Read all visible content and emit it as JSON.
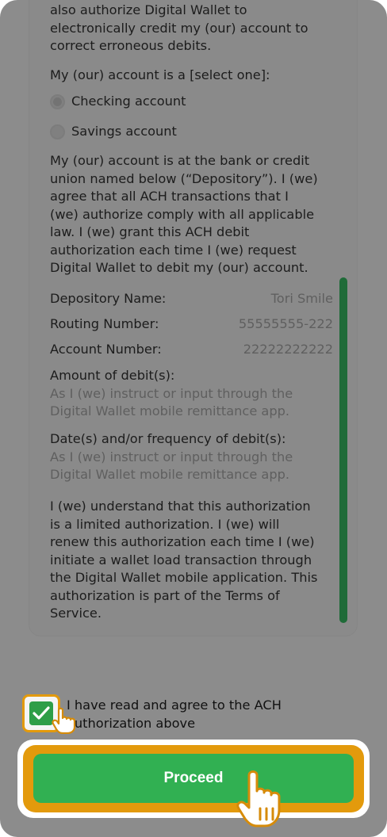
{
  "auth_text": {
    "intro_lines": [
      "also authorize Digital Wallet to",
      "electronically credit my (our) account to",
      "correct erroneous debits."
    ],
    "account_type_prompt": "My (our) account is a [select one]:",
    "account_options": [
      {
        "label": "Checking account",
        "selected": true
      },
      {
        "label": "Savings account",
        "selected": false
      }
    ],
    "depository_paragraph": [
      "My (our) account is at the bank or credit",
      "union named below (“Depository”). I (we)",
      "agree that all ACH transactions that I",
      "(we) authorize comply with all applicable",
      "law.  I (we) grant this ACH debit",
      "authorization each time I (we) request",
      "Digital Wallet to debit my (our) account."
    ],
    "fields": [
      {
        "label": "Depository Name:",
        "value": "Tori Smile"
      },
      {
        "label": "Routing Number:",
        "value": "55555555-222"
      },
      {
        "label": "Account Number:",
        "value": "22222222222"
      }
    ],
    "amount_label": "Amount of debit(s):",
    "amount_value_lines": [
      "As I (we) instruct or input through the",
      "Digital Wallet mobile remittance app."
    ],
    "date_label": "Date(s) and/or frequency of debit(s):",
    "date_value_lines": [
      "As I (we) instruct or input through the",
      "Digital Wallet mobile remittance app."
    ],
    "closing_paragraph": [
      "I (we) understand that this authorization",
      "is a limited authorization.  I (we) will",
      "renew this authorization each time I (we)",
      "initiate a wallet load transaction through",
      "the Digital Wallet mobile application. This",
      "authorization is part of the Terms of",
      "Service."
    ]
  },
  "agree": {
    "checked": true,
    "text_lines": [
      "I have read and agree to the ACH",
      "authorization above"
    ]
  },
  "proceed": {
    "label": "Proceed"
  },
  "colors": {
    "accent_green": "#31b052",
    "highlight_orange": "#e39a0c",
    "overlay_gray": "#8c8c8c"
  },
  "icons": [
    "check-icon",
    "pointer-hand-icon"
  ]
}
